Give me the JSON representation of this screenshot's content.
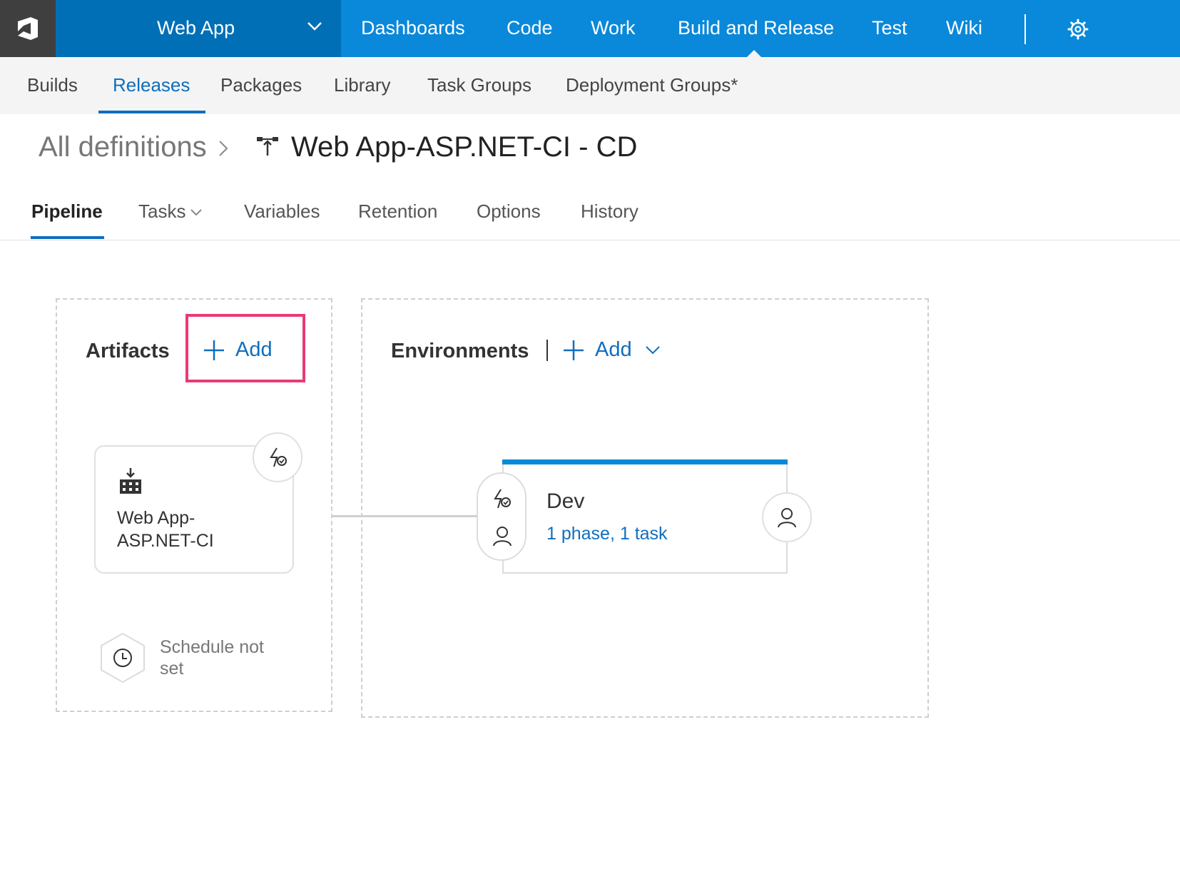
{
  "top_nav": {
    "project_name": "Web App",
    "items": [
      "Dashboards",
      "Code",
      "Work",
      "Build and Release",
      "Test",
      "Wiki"
    ],
    "active_item": "Build and Release",
    "logo_icon": "vsts-logo-icon",
    "settings_icon": "gear-icon"
  },
  "sub_nav": {
    "items": [
      "Builds",
      "Releases",
      "Packages",
      "Library",
      "Task Groups",
      "Deployment Groups*"
    ],
    "active_item": "Releases"
  },
  "breadcrumb": {
    "root": "All definitions",
    "title": "Web App-ASP.NET-CI - CD",
    "icon": "release-pipeline-icon"
  },
  "tabs": {
    "items": [
      "Pipeline",
      "Tasks",
      "Variables",
      "Retention",
      "Options",
      "History"
    ],
    "active_item": "Pipeline"
  },
  "artifacts": {
    "title": "Artifacts",
    "add_label": "Add",
    "artifact_name": "Web App-ASP.NET-CI",
    "schedule_text": "Schedule not set"
  },
  "environments": {
    "title": "Environments",
    "add_label": "Add",
    "environment_name": "Dev",
    "environment_summary": "1 phase, 1 task"
  },
  "colors": {
    "top_bar": "#0a88d9",
    "project_box": "#006fb6",
    "accent": "#106ebe",
    "highlight": "#ea3a73"
  }
}
